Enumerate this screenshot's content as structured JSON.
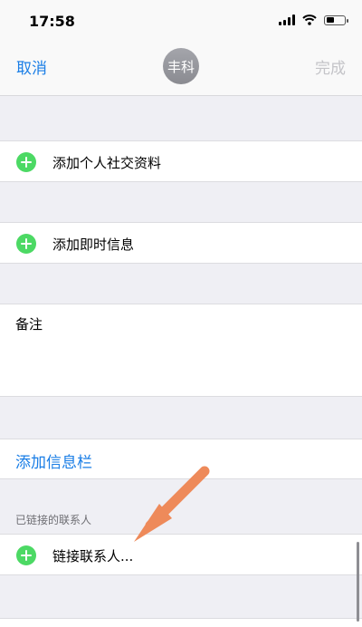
{
  "status": {
    "time": "17:58",
    "battery_level": 0.45
  },
  "nav": {
    "cancel": "取消",
    "avatar_text": "丰科",
    "done": "完成"
  },
  "rows": {
    "social": "添加个人社交资料",
    "im": "添加即时信息",
    "notes": "备注",
    "add_field": "添加信息栏",
    "linked_header": "已链接的联系人",
    "link_contact": "链接联系人..."
  },
  "colors": {
    "accent": "#1a7ee6",
    "add": "#4cd964",
    "arrow": "#ee8a5a"
  },
  "icons": {
    "add": "plus-circle-icon",
    "annotation": "arrow-icon"
  }
}
